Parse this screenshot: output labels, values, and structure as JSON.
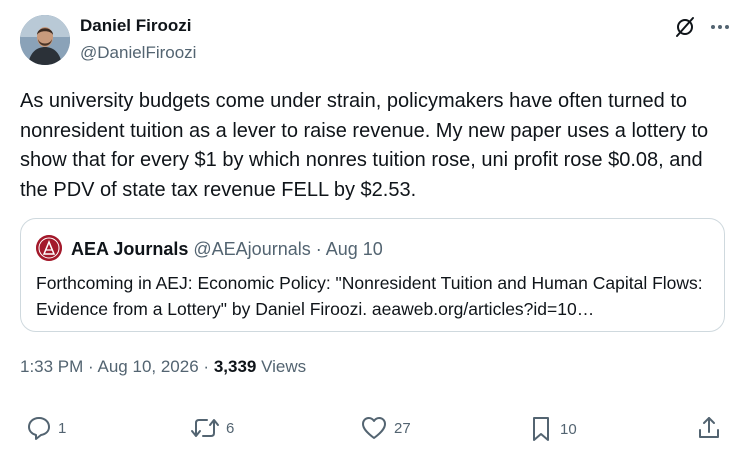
{
  "author": {
    "name": "Daniel Firoozi",
    "handle": "@DanielFiroozi"
  },
  "top_icons": [
    "grok-icon",
    "more-icon"
  ],
  "tweet": {
    "text": "As university budgets come under strain, policymakers have often turned to nonresident tuition as a lever to raise revenue. My new paper uses a lottery to show that for every $1 by which nonres tuition rose, uni profit rose $0.08, and the PDV of state tax revenue FELL by $2.53."
  },
  "quote": {
    "name": "AEA Journals",
    "handle": "@AEAjournals",
    "separator": "·",
    "date": "Aug 10",
    "text": "Forthcoming in AEJ: Economic Policy: \"Nonresident Tuition and Human Capital Flows: Evidence from a Lottery\" by Daniel Firoozi. aeaweb.org/articles?id=10…"
  },
  "meta": {
    "time": "1:33 PM",
    "separator": "·",
    "date": "Aug 10, 2026",
    "views_count": "3,339",
    "views_label": "Views"
  },
  "actions": {
    "replies": "1",
    "reposts": "6",
    "likes": "27",
    "bookmarks": "10"
  },
  "colors": {
    "text": "#0f1419",
    "secondary": "#536471",
    "border": "#cfd9de",
    "aea_brand": "#a3192b"
  }
}
